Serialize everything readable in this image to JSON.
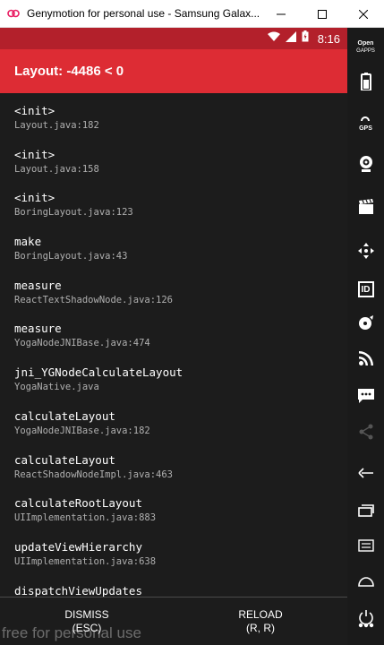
{
  "window": {
    "title": "Genymotion for personal use - Samsung Galax..."
  },
  "status_bar": {
    "time": "8:16"
  },
  "app_bar": {
    "title": "Layout: -4486 < 0"
  },
  "stack_frames": [
    {
      "method": "<init>",
      "file": "Layout.java:182"
    },
    {
      "method": "<init>",
      "file": "Layout.java:158"
    },
    {
      "method": "<init>",
      "file": "BoringLayout.java:123"
    },
    {
      "method": "make",
      "file": "BoringLayout.java:43"
    },
    {
      "method": "measure",
      "file": "ReactTextShadowNode.java:126"
    },
    {
      "method": "measure",
      "file": "YogaNodeJNIBase.java:474"
    },
    {
      "method": "jni_YGNodeCalculateLayout",
      "file": "YogaNative.java"
    },
    {
      "method": "calculateLayout",
      "file": "YogaNodeJNIBase.java:182"
    },
    {
      "method": "calculateLayout",
      "file": "ReactShadowNodeImpl.java:463"
    },
    {
      "method": "calculateRootLayout",
      "file": "UIImplementation.java:883"
    },
    {
      "method": "updateViewHierarchy",
      "file": "UIImplementation.java:638"
    },
    {
      "method": "dispatchViewUpdates",
      "file": ""
    }
  ],
  "buttons": {
    "dismiss_label": "DISMISS",
    "dismiss_hint": "(ESC)",
    "reload_label": "RELOAD",
    "reload_hint": "(R, R)"
  },
  "watermark": "free for personal use",
  "sidebar": {
    "open_gapps_line1": "Open",
    "open_gapps_line2": "GAPPS",
    "gps_label": "GPS",
    "id_label": "ID",
    "items": [
      "open-gapps-icon",
      "battery-icon",
      "gps-icon",
      "webcam-icon",
      "clapper-icon",
      "dpad-icon",
      "identifiers-icon",
      "disk-io-icon",
      "rss-icon",
      "sms-icon",
      "share-icon",
      "back-icon",
      "recent-apps-icon",
      "menu-icon",
      "home-icon",
      "power-icon",
      "more-icon"
    ]
  },
  "colors": {
    "status_bar": "#b3202b",
    "app_bar": "#dd2c34",
    "background": "#1c1c1c"
  }
}
